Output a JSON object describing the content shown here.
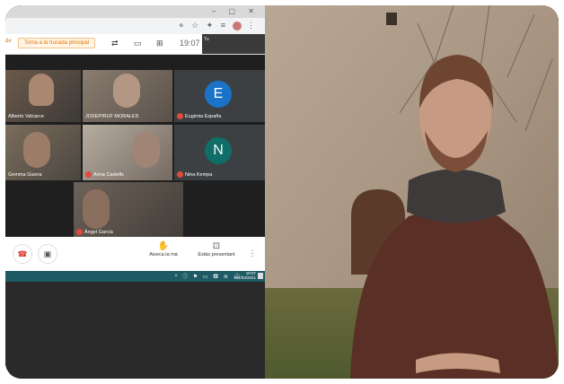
{
  "window": {
    "controls": "–   ▢   ✕"
  },
  "browser": {
    "toolbar_icons": "⋄ ☆ ✦ ≡",
    "menu_icon": "⋮"
  },
  "meet_bar": {
    "left_fragment": "de",
    "back_button": "Torna a la trucada principal",
    "tool_icons": [
      "⇄",
      "▭",
      "⊞"
    ],
    "clock": "19:07",
    "self_thumb_label": "Tu"
  },
  "participants": [
    {
      "name": "Alberto Valcarce",
      "muted": false
    },
    {
      "name": "JOSEP/RUF MORALES",
      "muted": false
    },
    {
      "name": "Eugènia España",
      "muted": true,
      "initial": "E",
      "color": "#1a73c8"
    },
    {
      "name": "Gemma Guiera",
      "muted": false
    },
    {
      "name": "Anna Castells",
      "muted": true
    },
    {
      "name": "Nina Kempa",
      "muted": true,
      "initial": "N",
      "color": "#0f6e67"
    },
    {
      "name": "Àngel Garcia",
      "muted": true
    }
  ],
  "controls": {
    "hangup_icon": "☎",
    "camera_icon": "▣",
    "raise_hand_icon": "✋",
    "raise_hand_label": "Aixeca la mà",
    "present_icon": "⊡",
    "present_label": "Estàs presentant",
    "more_icon": "⋮"
  },
  "taskbar": {
    "tray": "^ ⓘ ⚑ ▭ ☎ ≋ 🔊",
    "time": "19:07",
    "date": "04/03/2021"
  }
}
